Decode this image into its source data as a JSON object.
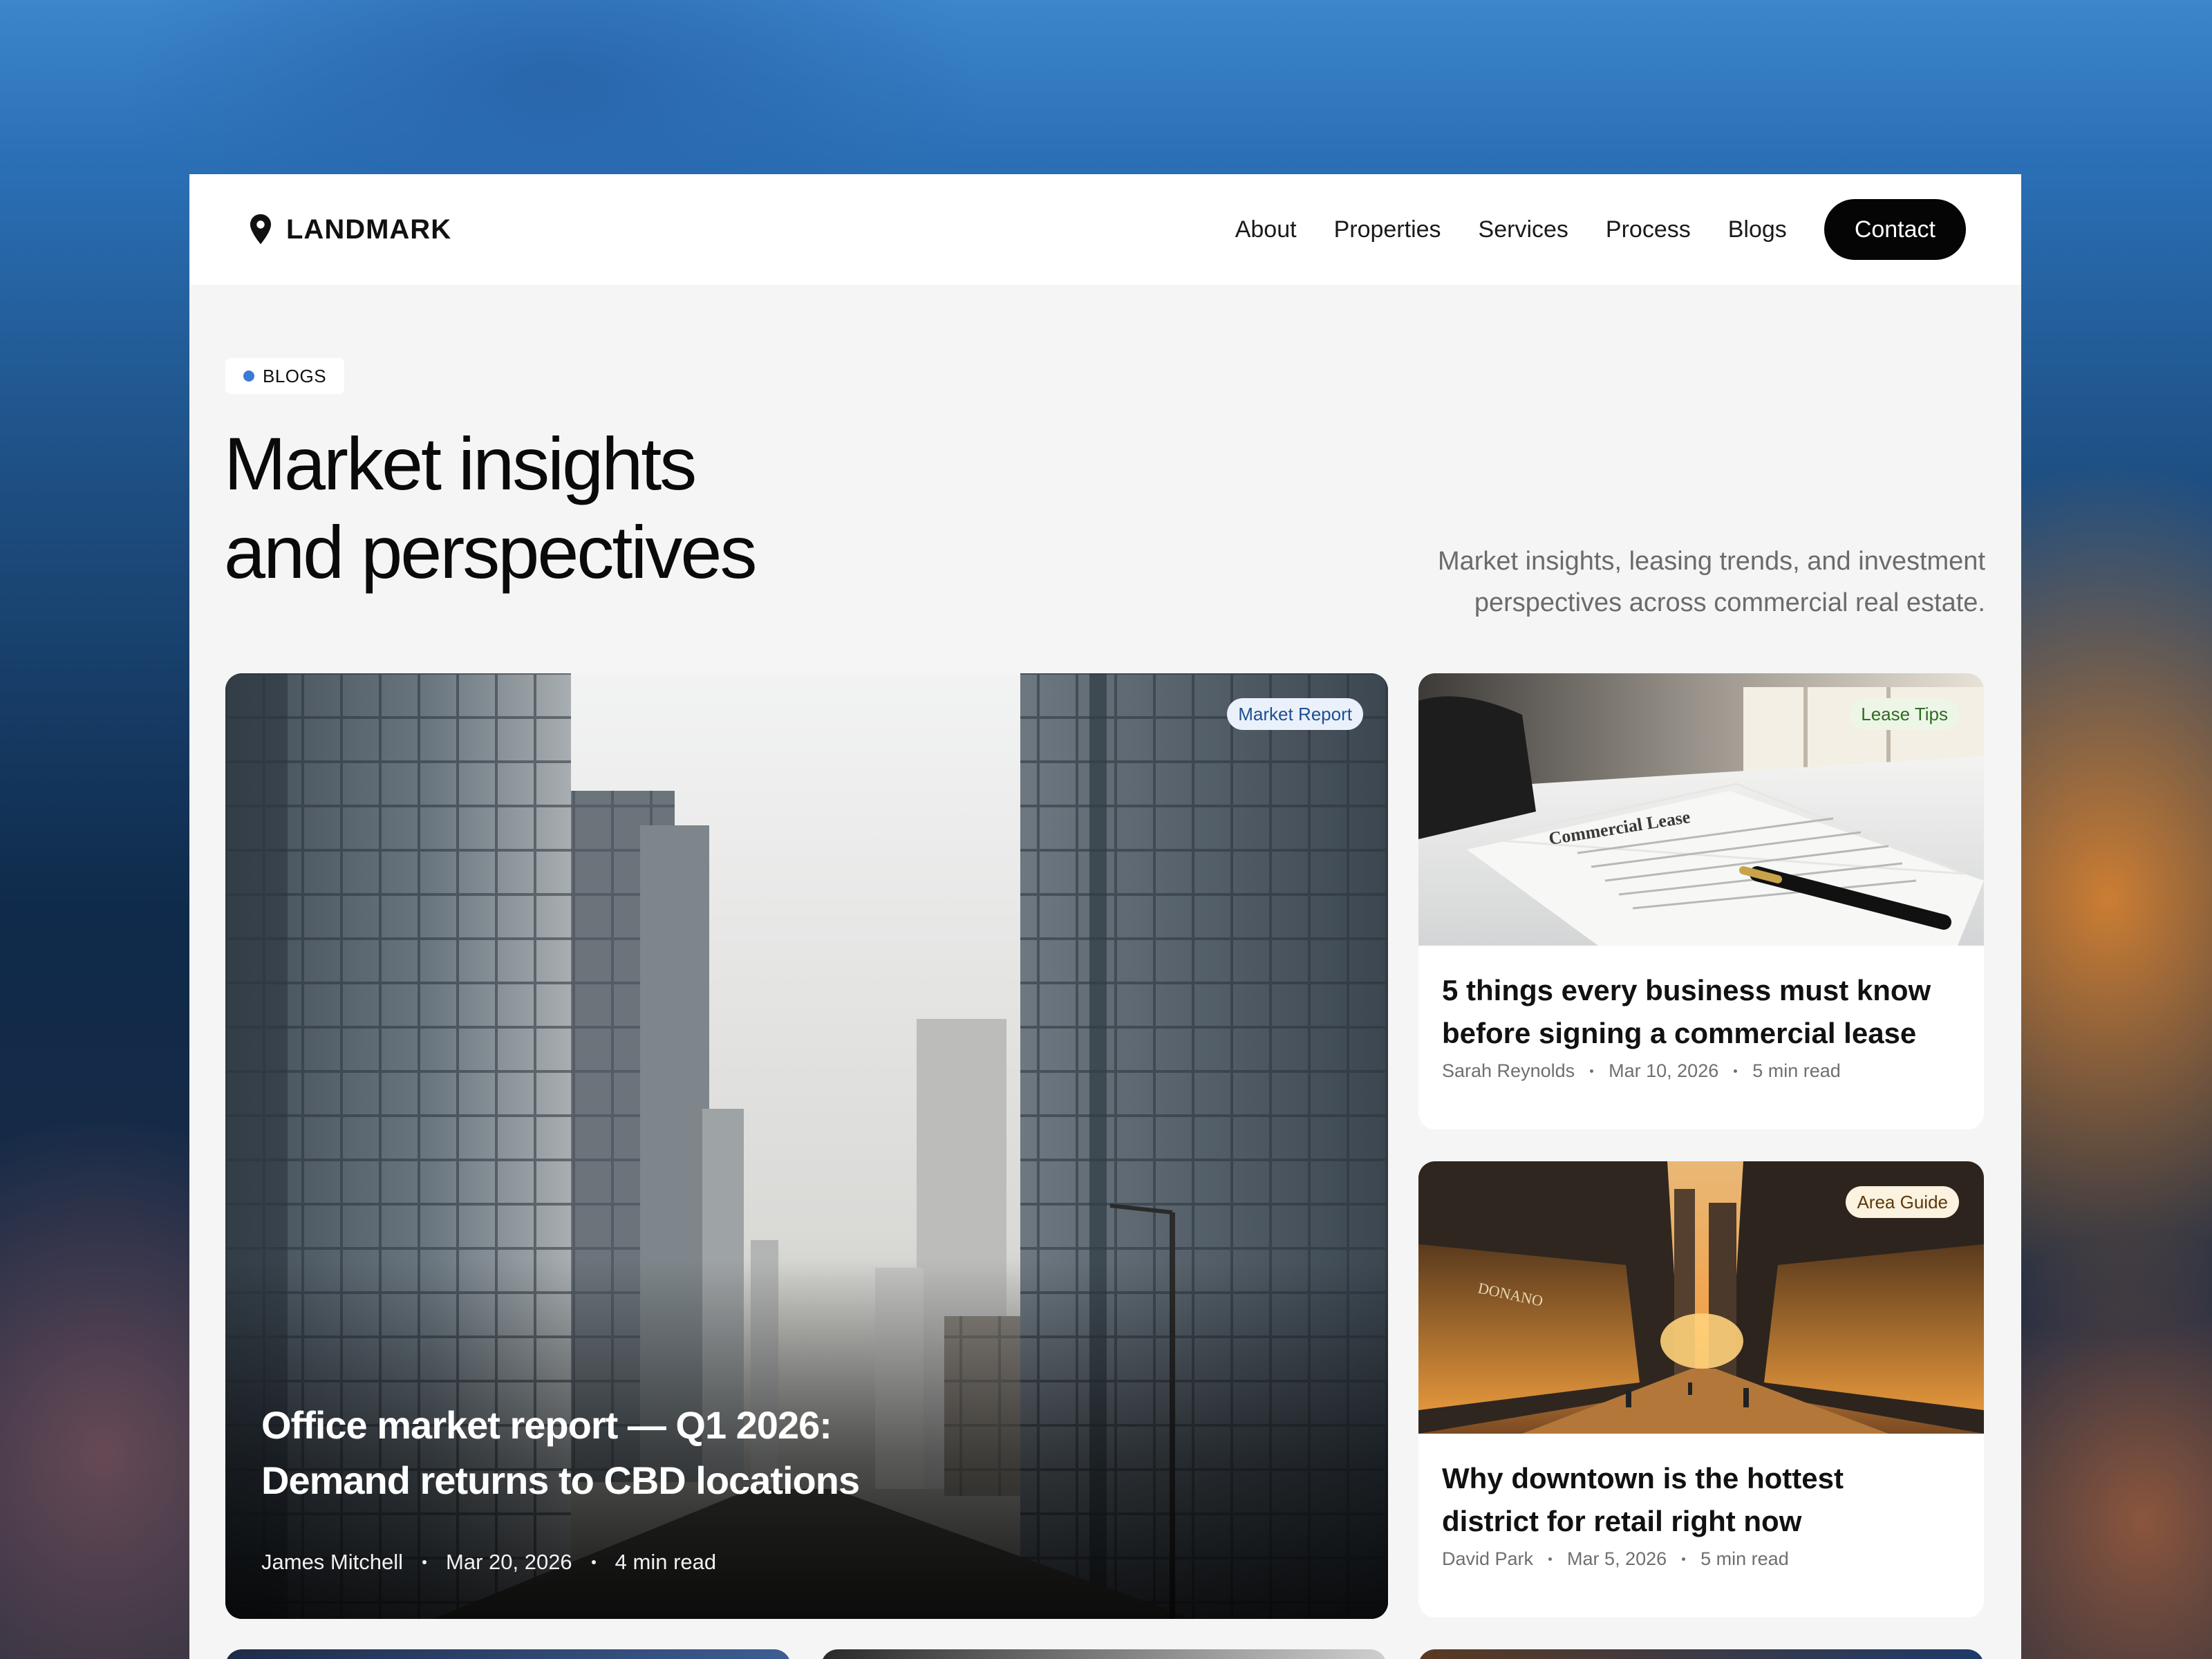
{
  "brand": {
    "name": "LANDMARK",
    "logo_icon": "map-pin-icon"
  },
  "nav": {
    "links": [
      "About",
      "Properties",
      "Services",
      "Process",
      "Blogs"
    ],
    "contact_label": "Contact"
  },
  "hero": {
    "badge": "BLOGS",
    "badge_color": "#3a7bd5",
    "headline_lines": [
      "Market insights",
      "and perspectives"
    ],
    "subtext_lines": [
      "Market insights, leasing trends, and investment",
      "perspectives across commercial real estate."
    ]
  },
  "featured": {
    "tag": "Market Report",
    "title_lines": [
      "Office market report — Q1 2026:",
      "Demand returns to CBD locations"
    ],
    "author": "James Mitchell",
    "date": "Mar 20, 2026",
    "read_time": "4 min read"
  },
  "articles": [
    {
      "tag": "Lease Tips",
      "title_lines": [
        "5 things every business must know",
        "before signing a commercial lease"
      ],
      "author": "Sarah Reynolds",
      "date": "Mar 10, 2026",
      "read_time": "5 min read"
    },
    {
      "tag": "Area Guide",
      "title_lines": [
        "Why downtown is the hottest",
        "district for retail right now"
      ],
      "author": "David Park",
      "date": "Mar 5, 2026",
      "read_time": "5 min read"
    }
  ],
  "image_text": {
    "document_heading": "Commercial Lease",
    "store_sign": "DONANO"
  },
  "colors": {
    "contact_bg": "#050505",
    "page_bg": "#f5f5f5",
    "accent_blue": "#3a7bd5"
  }
}
